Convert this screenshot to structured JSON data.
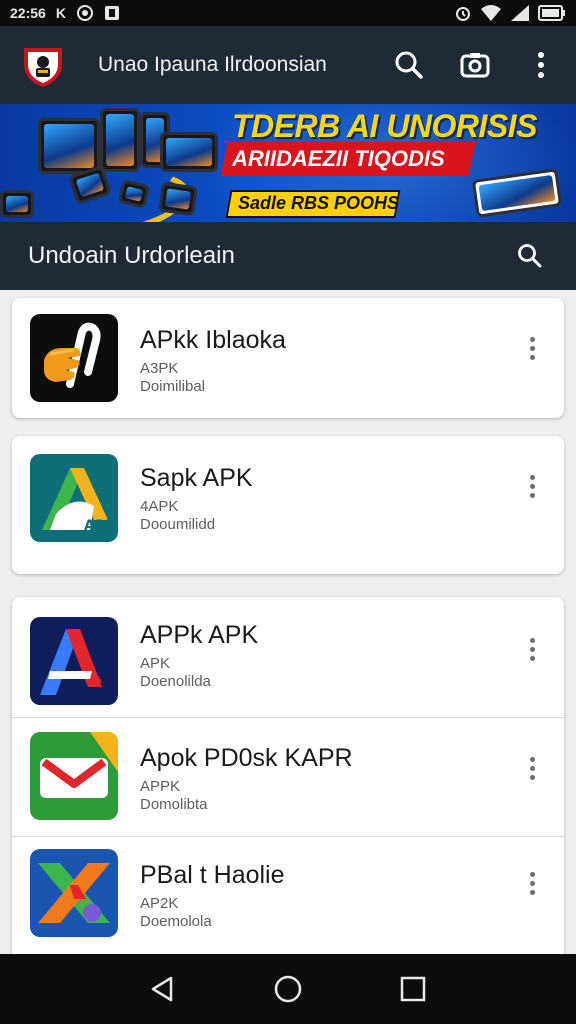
{
  "status_bar": {
    "time": "22:56",
    "indicators": "K",
    "icons": [
      "whatsapp-icon",
      "notification-icon",
      "alarm-icon",
      "wifi-icon",
      "signal-icon",
      "battery-icon"
    ]
  },
  "app_bar": {
    "title": "Unao Ipauna Ilrdoonsian",
    "actions": [
      "search-icon",
      "camera-icon",
      "more-vert-icon"
    ]
  },
  "banner": {
    "headline": "TDERB AI UNORISIS",
    "subline": "ARIIDAEZII TIQODIS",
    "tag": "Sadle RBS POOHS"
  },
  "section": {
    "title": "Undoain Urdorleain",
    "search_icon": "search-icon"
  },
  "apps": [
    {
      "name": "APkk  Iblaoka",
      "sub1": "A3PK",
      "sub2": "Doimilibal",
      "icon": "hand-logo-icon"
    },
    {
      "name": "Sapk  APK",
      "sub1": "4APK",
      "sub2": "Dooumilidd",
      "icon": "a-triangle-logo-icon"
    },
    {
      "name": "APPk  APK",
      "sub1": "APK",
      "sub2": "Doenolilda",
      "icon": "a-letter-logo-icon"
    },
    {
      "name": "Apok  PD0sk KAPR",
      "sub1": "APPK",
      "sub2": "Domolibta",
      "icon": "envelope-logo-icon"
    },
    {
      "name": "PBal t Haolie",
      "sub1": "AP2K",
      "sub2": "Doemolola",
      "icon": "x-shape-logo-icon"
    }
  ],
  "nav": [
    "back-icon",
    "home-icon",
    "recents-icon"
  ],
  "colors": {
    "app_bar": "#1f2a35",
    "banner_blue": "#0b4fc8",
    "promo_yellow": "#ffd800",
    "promo_red": "#d8141c"
  }
}
